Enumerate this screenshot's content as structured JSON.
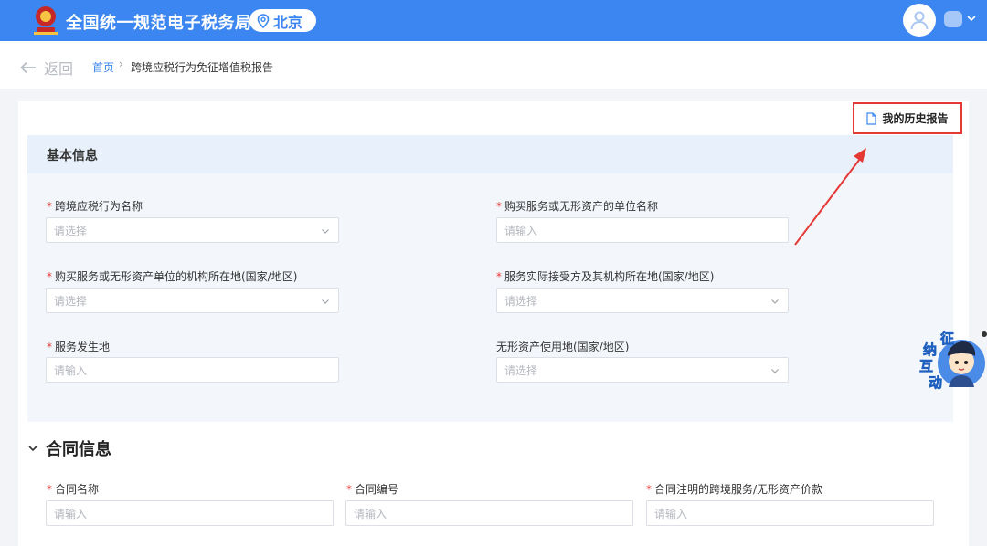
{
  "header": {
    "app_title": "全国统一规范电子税务局",
    "city": "北京",
    "colors": {
      "bar": "#3b86f0",
      "accent": "#3b86f0",
      "required": "#e53935"
    }
  },
  "subnav": {
    "back_label": "返回",
    "breadcrumb": {
      "home": "首页",
      "separator": "›",
      "current": "跨境应税行为免征增值税报告"
    }
  },
  "history_button": {
    "label": "我的历史报告"
  },
  "basic_info": {
    "title": "基本信息",
    "fields": [
      {
        "label": "跨境应税行为名称",
        "required": true,
        "type": "select",
        "placeholder": "请选择"
      },
      {
        "label": "购买服务或无形资产的单位名称",
        "required": true,
        "type": "input",
        "placeholder": "请输入"
      },
      {
        "label": "购买服务或无形资产单位的机构所在地(国家/地区)",
        "required": true,
        "type": "select",
        "placeholder": "请选择"
      },
      {
        "label": "服务实际接受方及其机构所在地(国家/地区)",
        "required": true,
        "type": "select",
        "placeholder": "请选择"
      },
      {
        "label": "服务发生地",
        "required": true,
        "type": "input",
        "placeholder": "请输入"
      },
      {
        "label": "无形资产使用地(国家/地区)",
        "required": false,
        "type": "select",
        "placeholder": "请选择"
      }
    ]
  },
  "contract_info": {
    "title": "合同信息",
    "fields": [
      {
        "label": "合同名称",
        "required": true,
        "type": "input",
        "placeholder": "请输入"
      },
      {
        "label": "合同编号",
        "required": true,
        "type": "input",
        "placeholder": "请输入"
      },
      {
        "label": "合同注明的跨境服务/无形资产价款",
        "required": true,
        "type": "input",
        "placeholder": "请输入"
      }
    ]
  },
  "assistant": {
    "text": "征纳互动"
  },
  "required_mark": "*"
}
